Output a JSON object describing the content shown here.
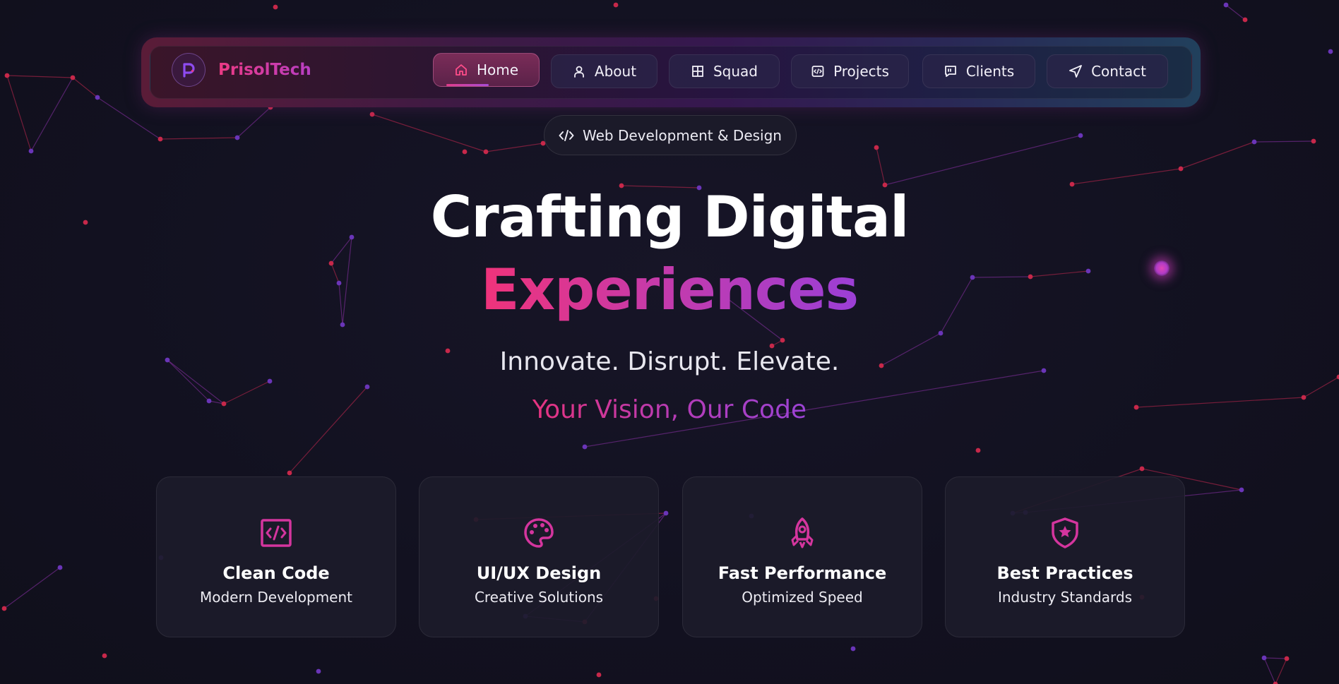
{
  "brand": {
    "name": "PrisolTech",
    "logo_icon": "p-logo-icon"
  },
  "nav": {
    "items": [
      {
        "label": "Home",
        "icon": "home-icon",
        "active": true
      },
      {
        "label": "About",
        "icon": "user-icon",
        "active": false
      },
      {
        "label": "Squad",
        "icon": "grid-icon",
        "active": false
      },
      {
        "label": "Projects",
        "icon": "code-window-icon",
        "active": false
      },
      {
        "label": "Clients",
        "icon": "quote-message-icon",
        "active": false
      },
      {
        "label": "Contact",
        "icon": "send-icon",
        "active": false
      }
    ]
  },
  "badge": {
    "label": "Web Development & Design",
    "icon": "code-icon"
  },
  "hero": {
    "title_line1": "Crafting Digital",
    "title_line2": "Experiences",
    "tagline": "Innovate. Disrupt. Elevate.",
    "subtagline": "Your Vision, Our Code"
  },
  "cards": [
    {
      "title": "Clean Code",
      "subtitle": "Modern Development",
      "icon": "code-file-icon"
    },
    {
      "title": "UI/UX Design",
      "subtitle": "Creative Solutions",
      "icon": "palette-icon"
    },
    {
      "title": "Fast Performance",
      "subtitle": "Optimized Speed",
      "icon": "rocket-icon"
    },
    {
      "title": "Best Practices",
      "subtitle": "Industry Standards",
      "icon": "shield-star-icon"
    }
  ],
  "colors": {
    "background": "#13121f",
    "accent_pink": "#f0337a",
    "accent_purple": "#9b3fd6",
    "card_icon": "#d4359e",
    "particle_red": "#c7284a",
    "particle_purple": "#6a35b8"
  }
}
